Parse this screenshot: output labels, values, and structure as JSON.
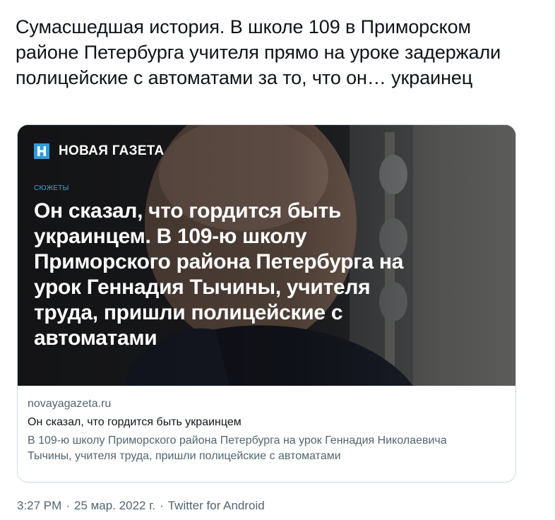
{
  "tweet": {
    "text": "Сумасшедшая история. В школе 109 в Приморском районе Петербурга учителя прямо на уроке задержали полицейские с автоматами за то, что он… украинец"
  },
  "card": {
    "brand": "НОВАЯ ГАЗЕТА",
    "logo_icon": "novaya-gazeta-logo-icon",
    "section": "СЮЖЕТЫ",
    "headline": "Он сказал, что гордится быть украинцем. В 109-ю школу Приморского района Петербурга на урок Геннадия Тычины, учителя труда, пришли полицейские с автоматами",
    "domain": "novayagazeta.ru",
    "title": "Он сказал, что гордится быть украинцем",
    "description": "В 109-ю школу Приморского района Петербурга на урок Геннадия Николаевича Тычины, учителя труда, пришли полицейские с автоматами"
  },
  "footer": {
    "time": "3:27 PM",
    "date": "25 мар. 2022 г.",
    "source": "Twitter for Android",
    "separator": "·"
  },
  "colors": {
    "text": "#0f1419",
    "secondary": "#536471",
    "border": "#cfd9de",
    "brand_blue": "#2d9cdb"
  }
}
